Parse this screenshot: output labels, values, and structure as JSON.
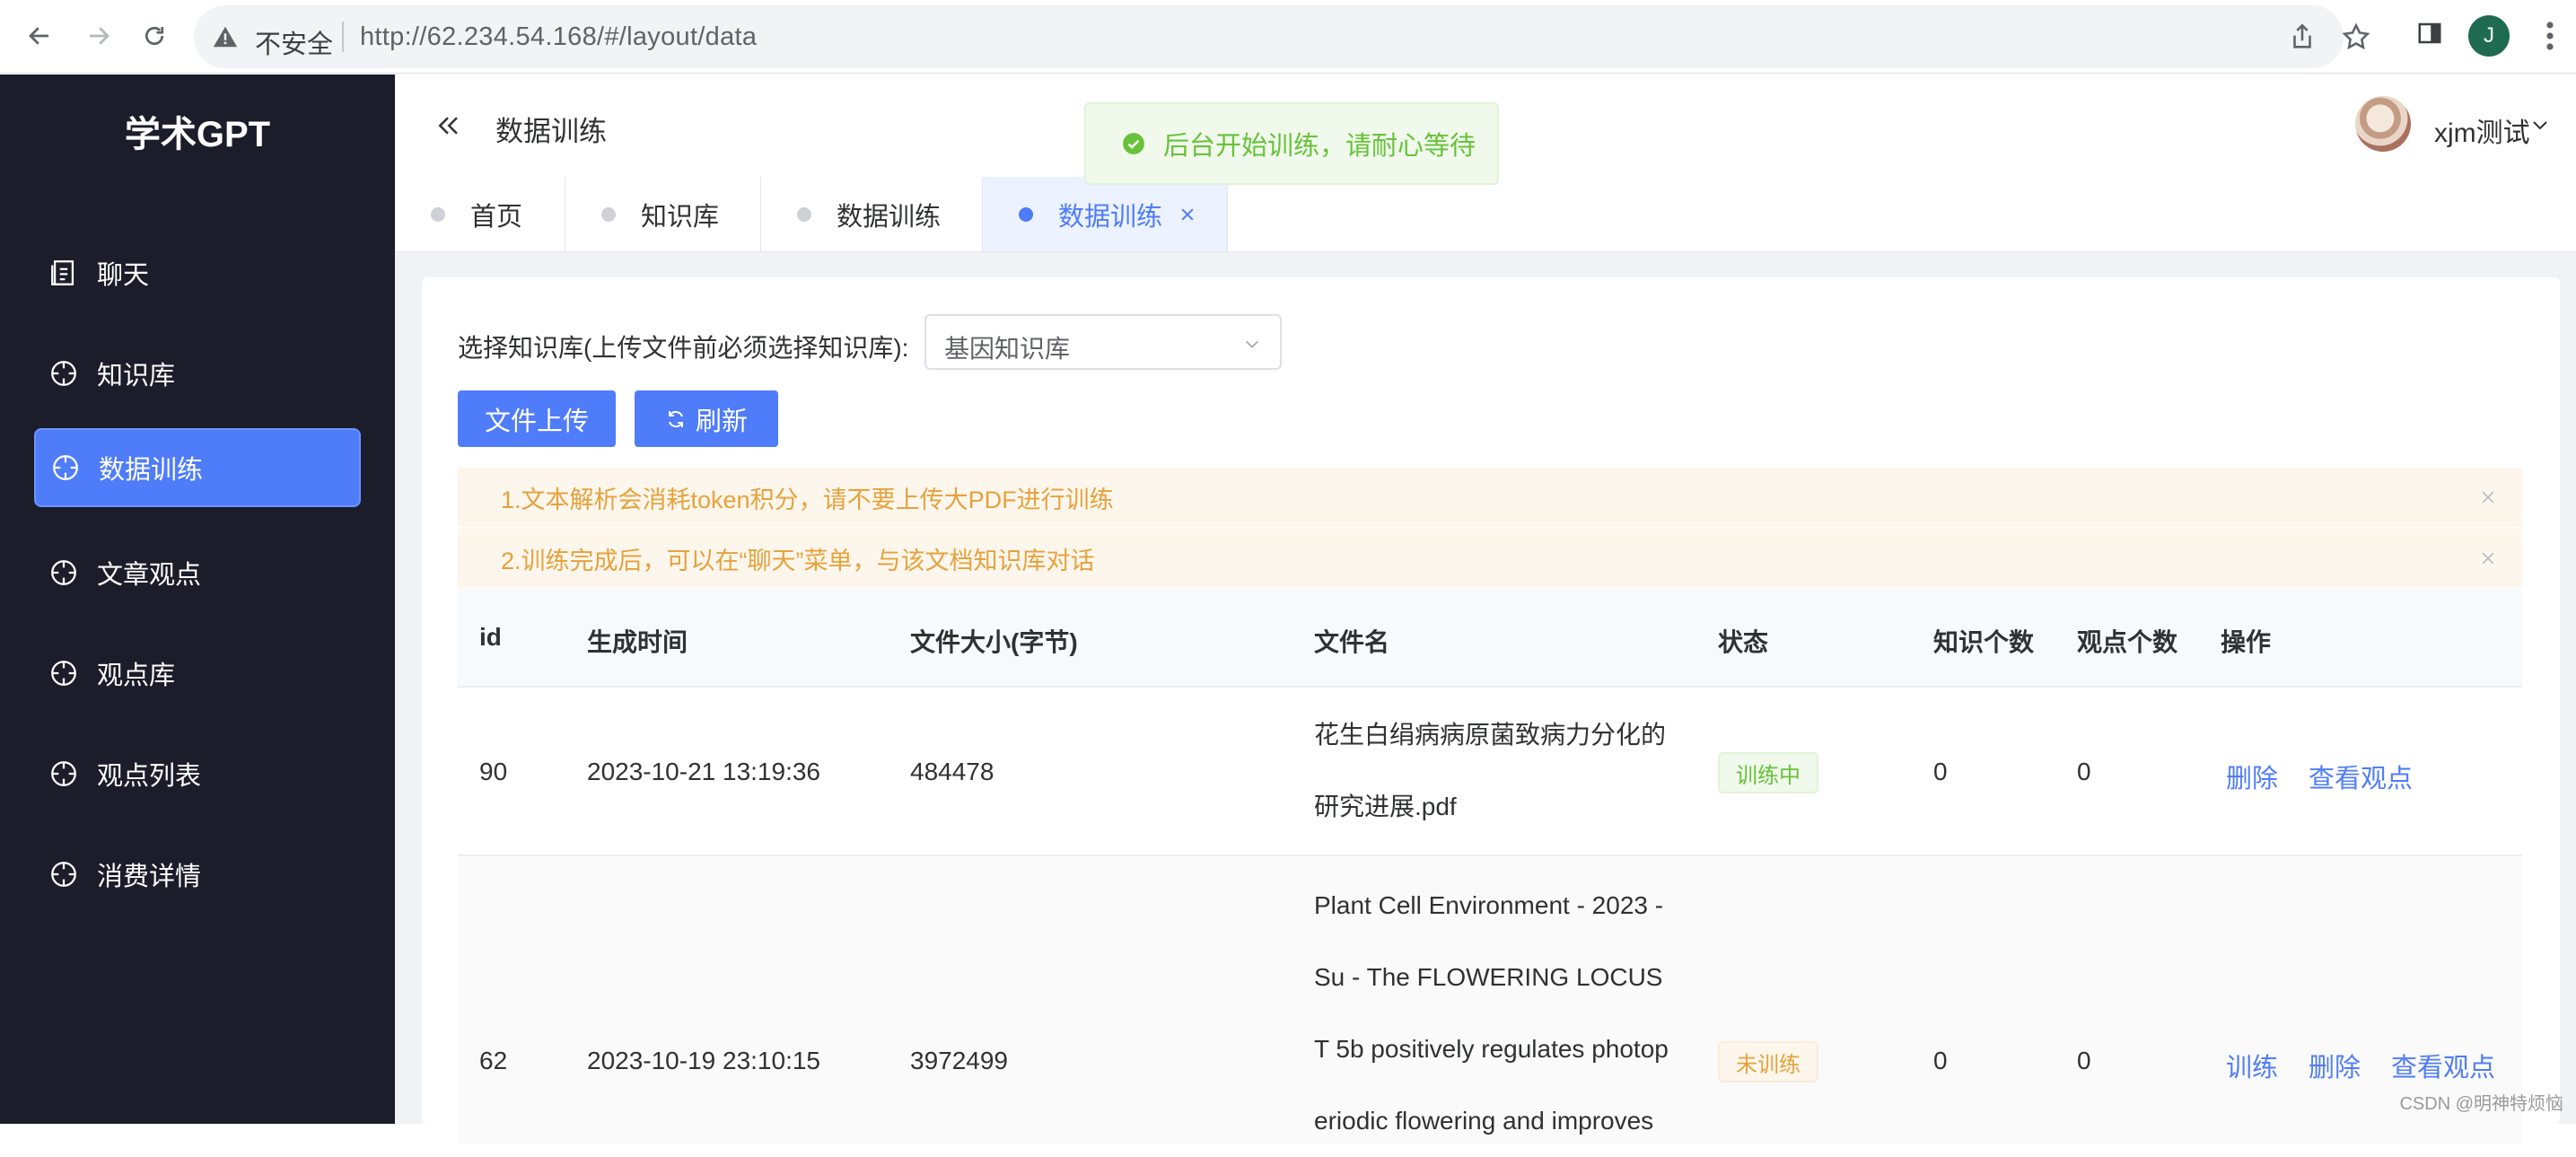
{
  "browser": {
    "insecure_label": "不安全",
    "url": "http://62.234.54.168/#/layout/data",
    "profile_initial": "J"
  },
  "sidebar": {
    "brand": "学术GPT",
    "items": [
      {
        "label": "聊天",
        "icon": "chat-doc-icon"
      },
      {
        "label": "知识库",
        "icon": "compass-icon"
      },
      {
        "label": "数据训练",
        "icon": "compass-icon",
        "active": true
      },
      {
        "label": "文章观点",
        "icon": "compass-icon"
      },
      {
        "label": "观点库",
        "icon": "compass-icon"
      },
      {
        "label": "观点列表",
        "icon": "compass-icon"
      },
      {
        "label": "消费详情",
        "icon": "compass-icon"
      }
    ]
  },
  "header": {
    "title": "数据训练",
    "username": "xjm测试"
  },
  "toast": {
    "message": "后台开始训练，请耐心等待"
  },
  "tabs": [
    {
      "label": "首页"
    },
    {
      "label": "知识库"
    },
    {
      "label": "数据训练"
    },
    {
      "label": "数据训练",
      "active": true
    }
  ],
  "form": {
    "kb_label": "选择知识库(上传文件前必须选择知识库):",
    "kb_selected": "基因知识库",
    "upload_button": "文件上传",
    "refresh_button": "刷新"
  },
  "alerts": [
    "1.文本解析会消耗token积分，请不要上传大PDF进行训练",
    "2.训练完成后，可以在“聊天”菜单，与该文档知识库对话"
  ],
  "table": {
    "columns": [
      "id",
      "生成时间",
      "文件大小(字节)",
      "文件名",
      "状态",
      "知识个数",
      "观点个数",
      "操作"
    ],
    "rows": [
      {
        "id": "90",
        "time": "2023-10-21 13:19:36",
        "size": "484478",
        "filename_lines": [
          "花生白绢病病原菌致病力分化的",
          "研究进展.pdf"
        ],
        "status": "训练中",
        "knowledge": "0",
        "views": "0",
        "actions": [
          "删除",
          "查看观点"
        ]
      },
      {
        "id": "62",
        "time": "2023-10-19 23:10:15",
        "size": "3972499",
        "filename_lines": [
          "Plant Cell Environment - 2023 -",
          "Su - The FLOWERING LOCUS",
          "T 5b positively regulates photop",
          "eriodic flowering and improves"
        ],
        "status": "未训练",
        "knowledge": "0",
        "views": "0",
        "actions": [
          "训练",
          "删除",
          "查看观点"
        ]
      }
    ]
  },
  "watermark": "CSDN @明神特烦恼"
}
